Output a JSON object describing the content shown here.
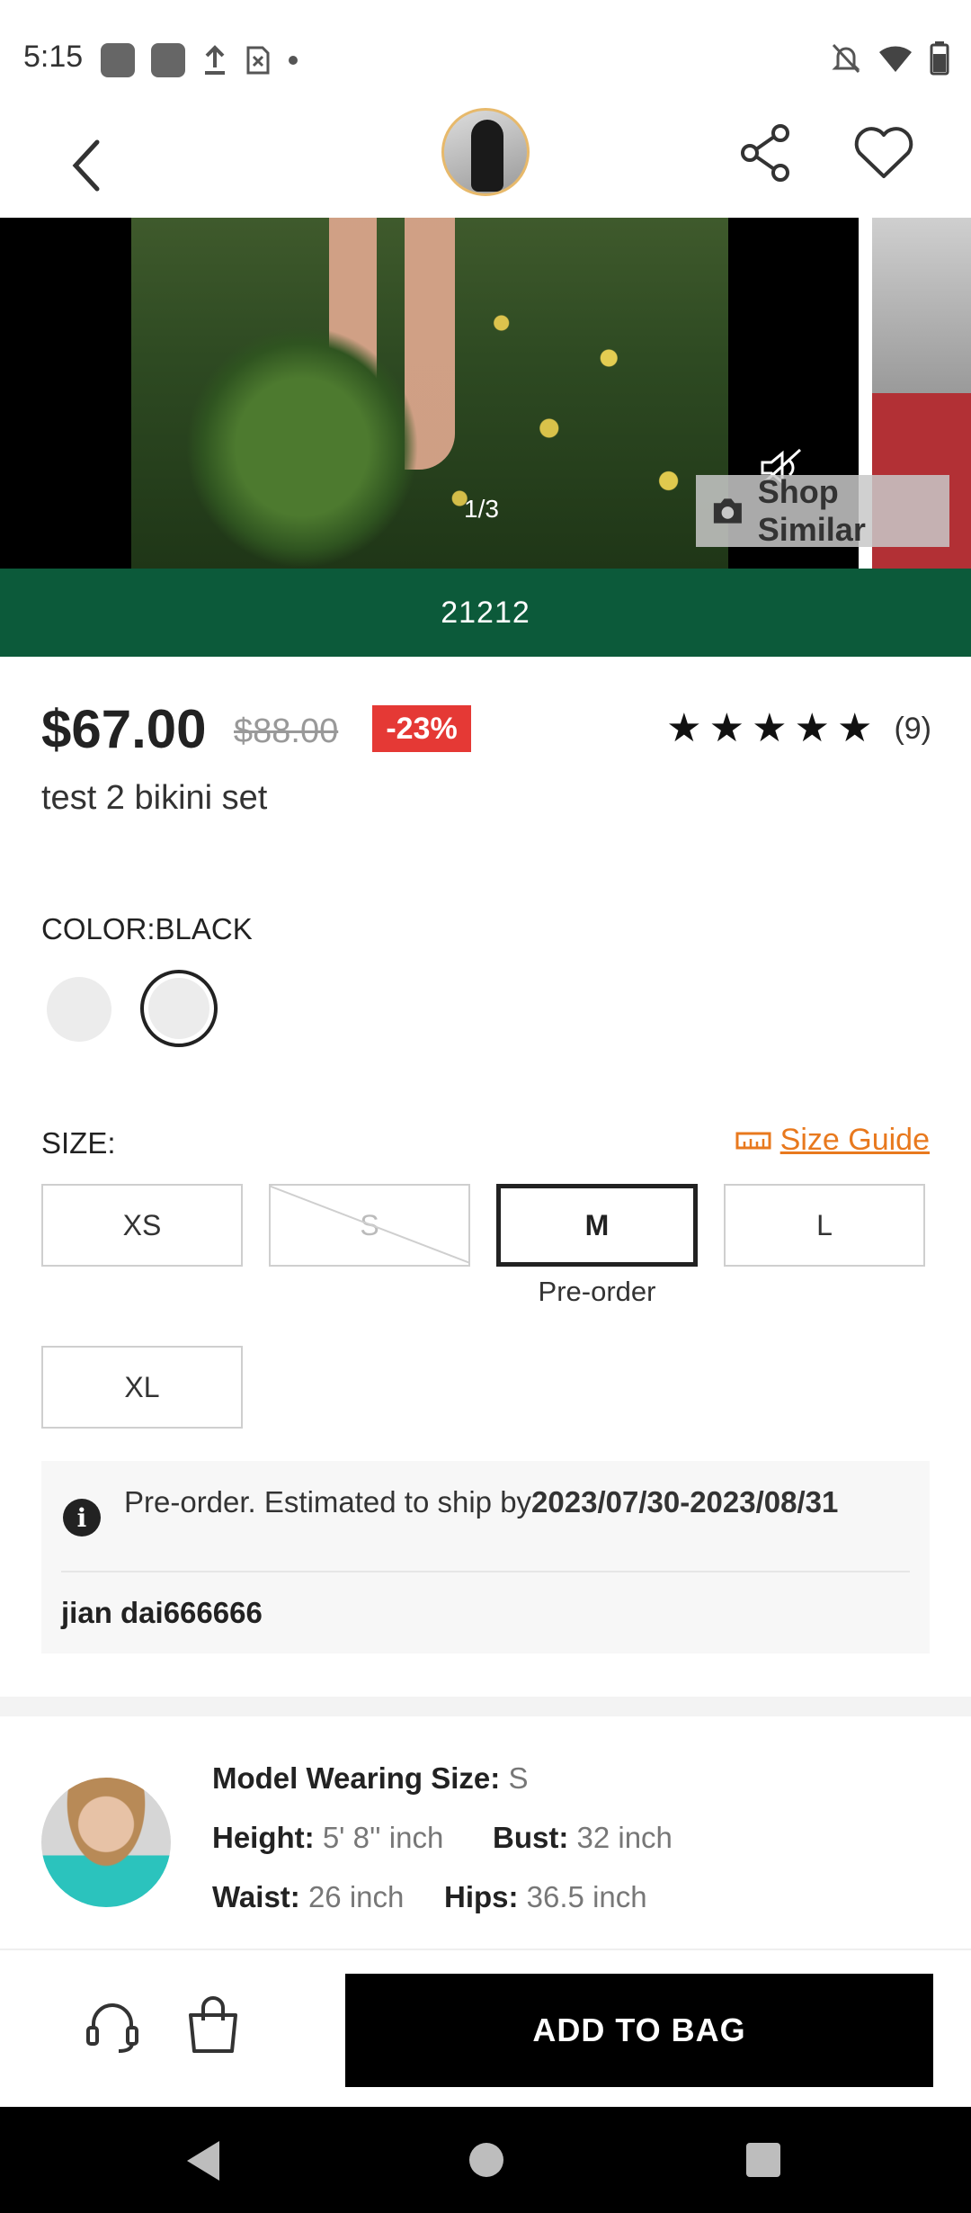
{
  "status_bar": {
    "time": "5:15"
  },
  "gallery": {
    "counter": "1/3",
    "shop_similar_label": "Shop Similar"
  },
  "promo": {
    "code": "21212"
  },
  "product": {
    "price_now": "$67.00",
    "price_old": "$88.00",
    "discount": "-23%",
    "rating_stars": 5,
    "review_count": "(9)",
    "title": "test 2 bikini set"
  },
  "color": {
    "label": "COLOR:BLACK",
    "swatches": [
      {
        "color": "#ececec"
      },
      {
        "color": "#ececec",
        "selected": true
      }
    ]
  },
  "size": {
    "label": "SIZE:",
    "guide_label": "Size Guide",
    "options": [
      {
        "label": "XS",
        "state": "available"
      },
      {
        "label": "S",
        "state": "unavailable"
      },
      {
        "label": "M",
        "state": "selected"
      },
      {
        "label": "L",
        "state": "available"
      },
      {
        "label": "XL",
        "state": "available"
      }
    ],
    "selected_note": "Pre-order"
  },
  "info": {
    "text_prefix": "Pre-order. Estimated to ship by",
    "ship_range": "2023/07/30-2023/08/31",
    "note": "jian dai666666"
  },
  "model": {
    "wearing_label": "Model Wearing Size:",
    "wearing_value": "S",
    "height_label": "Height:",
    "height_value": "5' 8'' inch",
    "bust_label": "Bust:",
    "bust_value": "32 inch",
    "waist_label": "Waist:",
    "waist_value": "26 inch",
    "hips_label": "Hips:",
    "hips_value": "36.5 inch"
  },
  "bottom": {
    "add_to_bag_label": "ADD TO BAG"
  },
  "colors": {
    "promo_green": "#0c5a3a",
    "discount_red": "#e53935",
    "size_guide_orange": "#e8791e"
  }
}
